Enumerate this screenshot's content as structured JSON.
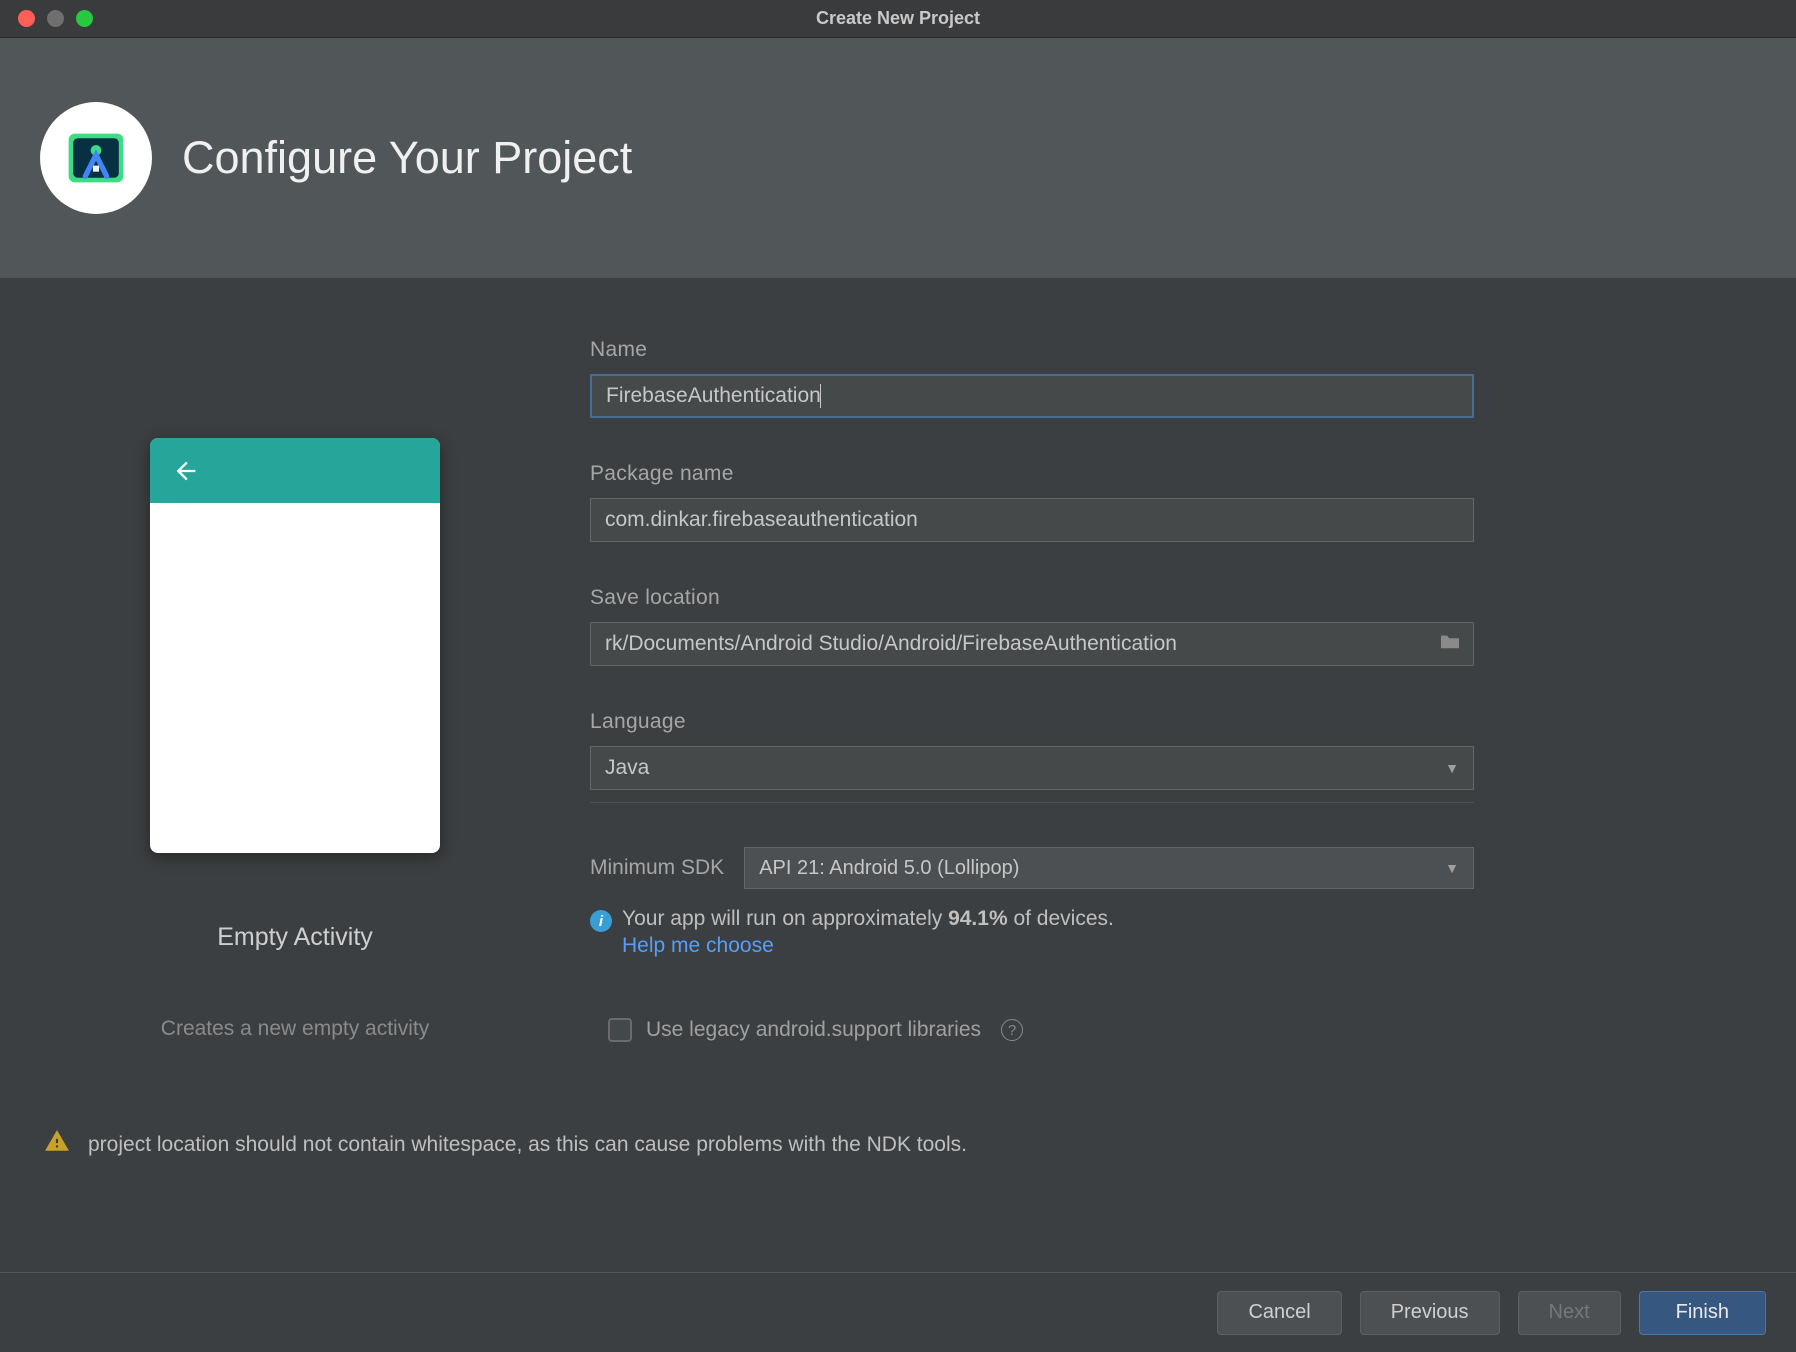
{
  "window": {
    "title": "Create New Project"
  },
  "header": {
    "title": "Configure Your Project"
  },
  "preview": {
    "title": "Empty Activity",
    "description": "Creates a new empty activity"
  },
  "form": {
    "name_label": "Name",
    "name_value": "FirebaseAuthentication",
    "package_label": "Package name",
    "package_value": "com.dinkar.firebaseauthentication",
    "save_label": "Save location",
    "save_value": "rk/Documents/Android Studio/Android/FirebaseAuthentication",
    "language_label": "Language",
    "language_value": "Java",
    "sdk_label": "Minimum SDK",
    "sdk_value": "API 21: Android 5.0 (Lollipop)",
    "info_prefix": "Your app will run on approximately ",
    "info_percent": "94.1%",
    "info_suffix": " of devices.",
    "help_link": "Help me choose",
    "legacy_label": "Use legacy android.support libraries"
  },
  "warning": {
    "text": "project location should not contain whitespace, as this can cause problems with the NDK tools."
  },
  "footer": {
    "cancel": "Cancel",
    "previous": "Previous",
    "next": "Next",
    "finish": "Finish"
  }
}
